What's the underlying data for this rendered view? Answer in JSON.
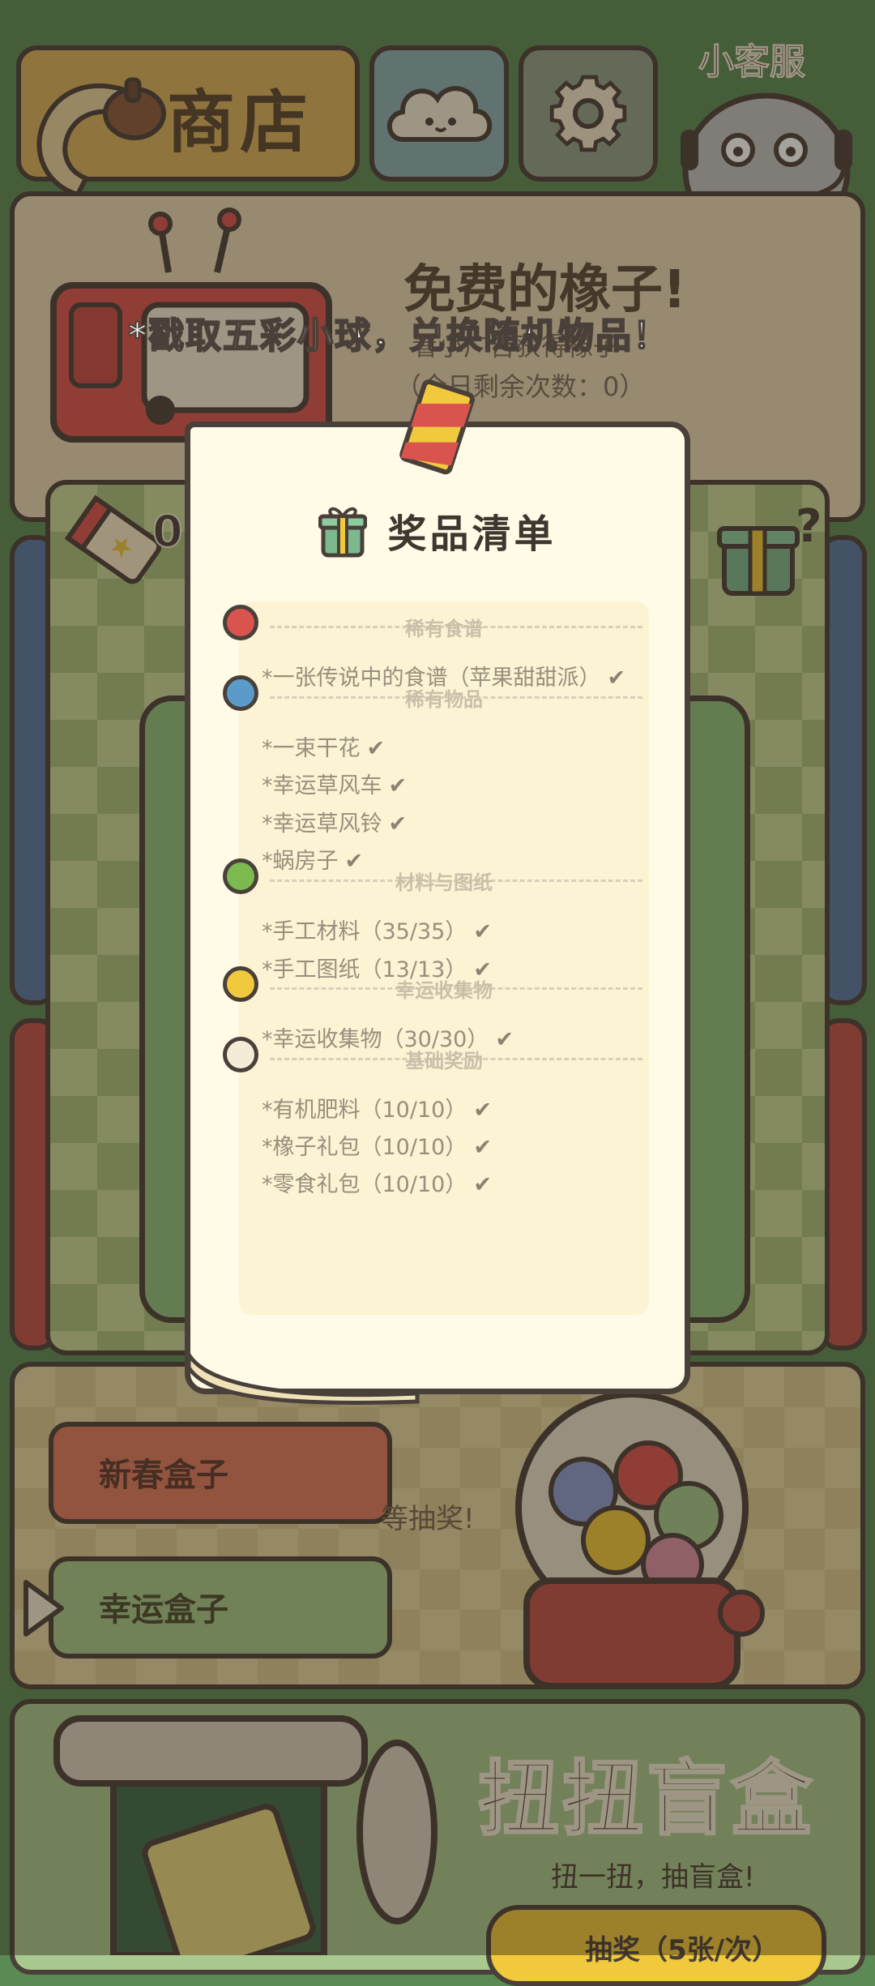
{
  "header": {
    "shop_title": "商店",
    "customer_service": "小客服"
  },
  "free_acorns": {
    "title": "免费的橡子!",
    "desc": "看小广告获得橡子",
    "remaining": "（今日剩余次数：0）"
  },
  "banner_tip": "*戳取五彩小球，兑换随机物品！",
  "ticket_count": "0",
  "prize_list": {
    "title": "奖品清单",
    "sections": [
      {
        "title": "稀有食谱",
        "color": "#d9534f",
        "items": [
          "*一张传说中的食谱（苹果甜甜派）"
        ]
      },
      {
        "title": "稀有物品",
        "color": "#5b9bc9",
        "items": [
          "*一束干花",
          "*幸运草风车",
          "*幸运草风铃",
          "*蜗房子"
        ]
      },
      {
        "title": "材料与图纸",
        "color": "#7cb94f",
        "items": [
          "*手工材料（35/35）",
          "*手工图纸（13/13）"
        ]
      },
      {
        "title": "幸运收集物",
        "color": "#f0c93c",
        "items": [
          "*幸运收集物（30/30）"
        ]
      },
      {
        "title": "基础奖励",
        "color": "#f3ecd6",
        "items": [
          "*有机肥料（10/10）",
          "*橡子礼包（10/10）",
          "*零食礼包（10/10）"
        ]
      }
    ],
    "check_mark": "✔"
  },
  "boxes": {
    "spring_box": "新春盒子",
    "lucky_box": "幸运盒子",
    "hint_tail": "等抽奖!"
  },
  "gacha": {
    "title": "扭扭盲盒",
    "subtitle": "扭一扭，抽盲盒!",
    "draw_button": "抽奖（5张/次）"
  },
  "colors": {
    "background": "#5b8a55",
    "shop": "#d9b15e",
    "paper": "#fffbe6",
    "outline": "#4a403a"
  }
}
